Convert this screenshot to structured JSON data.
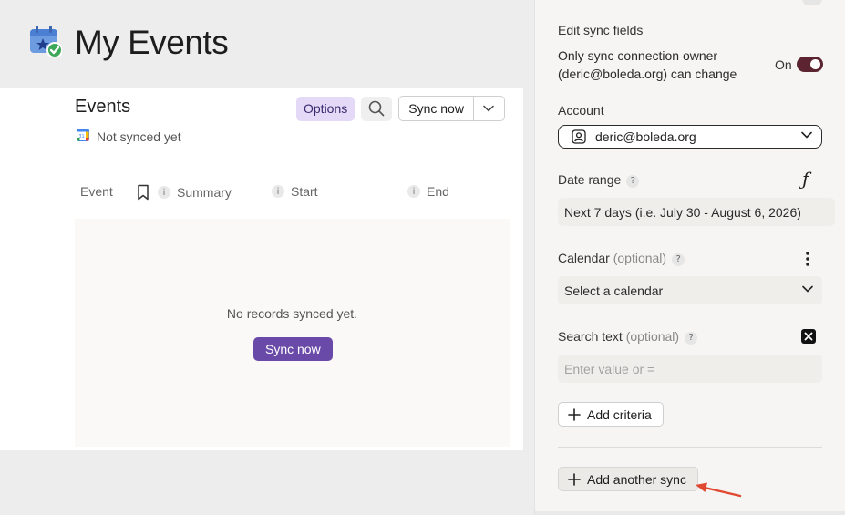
{
  "page": {
    "title": "My Events"
  },
  "card": {
    "title": "Events",
    "sync_status": "Not synced yet",
    "calendar_badge": "31",
    "toolbar": {
      "options_label": "Options",
      "sync_now_label": "Sync now"
    },
    "columns": [
      {
        "label": "Event"
      },
      {
        "label": "Summary"
      },
      {
        "label": "Start"
      },
      {
        "label": "End"
      }
    ],
    "info_glyph": "i",
    "empty": {
      "message": "No records synced yet.",
      "button_label": "Sync now"
    }
  },
  "panel": {
    "edit_sync_fields_label": "Edit sync fields",
    "owner_note": "Only sync connection owner (deric@boleda.org) can change",
    "toggle": {
      "label": "On",
      "state": true
    },
    "account": {
      "label": "Account",
      "value": "deric@boleda.org"
    },
    "date_range": {
      "label": "Date range",
      "value": "Next 7 days (i.e. July 30 - August 6, 2026)",
      "formula_icon": "ƒ"
    },
    "calendar": {
      "label": "Calendar",
      "optional": "(optional)",
      "placeholder": "Select a calendar"
    },
    "search_text": {
      "label": "Search text",
      "optional": "(optional)",
      "placeholder": "Enter value or ="
    },
    "help_glyph": "?",
    "add_criteria_label": "Add criteria",
    "add_another_sync_label": "Add another sync"
  },
  "colors": {
    "accent": "#6a4aa8",
    "options_bg": "#e4daf7",
    "toggle_on": "#5b2430",
    "arrow": "#e0482f"
  }
}
